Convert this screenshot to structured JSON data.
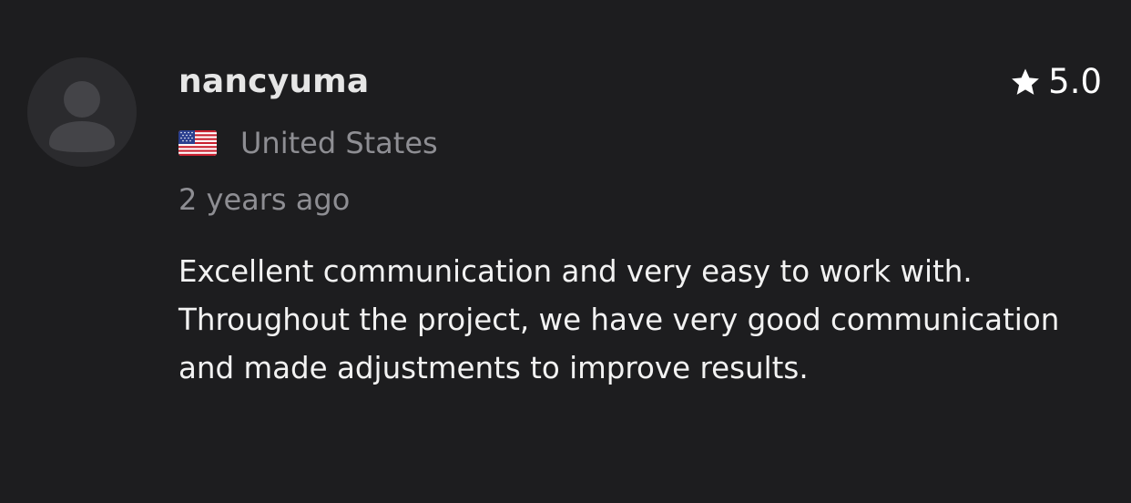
{
  "review": {
    "avatar_icon": "user-placeholder-icon",
    "username": "nancyuma",
    "rating": {
      "icon": "star-icon",
      "value": "5.0"
    },
    "location": {
      "flag_icon": "us-flag-icon",
      "country": "United States"
    },
    "time_ago": "2 years ago",
    "text": "Excellent communication and very easy to work with. Throughout the project, we have very good communication and made adjustments to improve results."
  },
  "colors": {
    "background": "#1d1d1f",
    "avatar_bg": "#2b2b2e",
    "avatar_fg": "#444448",
    "username": "#e6e6e6",
    "muted": "#8e8e93",
    "body": "#f2f2f2"
  }
}
